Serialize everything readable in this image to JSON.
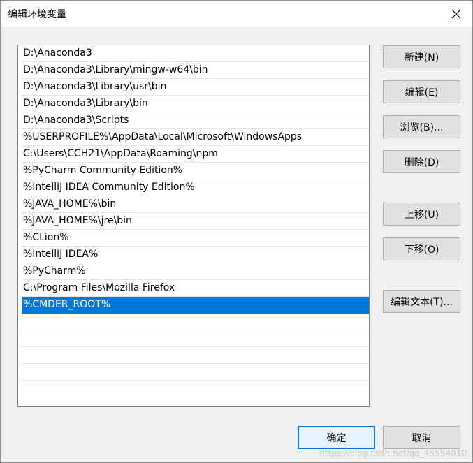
{
  "window": {
    "title": "编辑环境变量"
  },
  "icons": {
    "close": "close-icon"
  },
  "paths": [
    "D:\\Anaconda3",
    "D:\\Anaconda3\\Library\\mingw-w64\\bin",
    "D:\\Anaconda3\\Library\\usr\\bin",
    "D:\\Anaconda3\\Library\\bin",
    "D:\\Anaconda3\\Scripts",
    "%USERPROFILE%\\AppData\\Local\\Microsoft\\WindowsApps",
    "C:\\Users\\CCH21\\AppData\\Roaming\\npm",
    "%PyCharm Community Edition%",
    "%IntelliJ IDEA Community Edition%",
    "%JAVA_HOME%\\bin",
    "%JAVA_HOME%\\jre\\bin",
    "%CLion%",
    "%IntelliJ IDEA%",
    "%PyCharm%",
    "C:\\Program Files\\Mozilla Firefox",
    "%CMDER_ROOT%"
  ],
  "selected_index": 15,
  "buttons": {
    "new": "新建(N)",
    "edit": "编辑(E)",
    "browse": "浏览(B)...",
    "delete": "删除(D)",
    "move_up": "上移(U)",
    "move_down": "下移(O)",
    "edit_text": "编辑文本(T)...",
    "ok": "确定",
    "cancel": "取消"
  },
  "watermark": "https://blog.csdn.net/qq_45554010",
  "colors": {
    "selection": "#0078d7",
    "button_face": "#e1e1e1",
    "dialog_bg": "#f0f0f0"
  }
}
